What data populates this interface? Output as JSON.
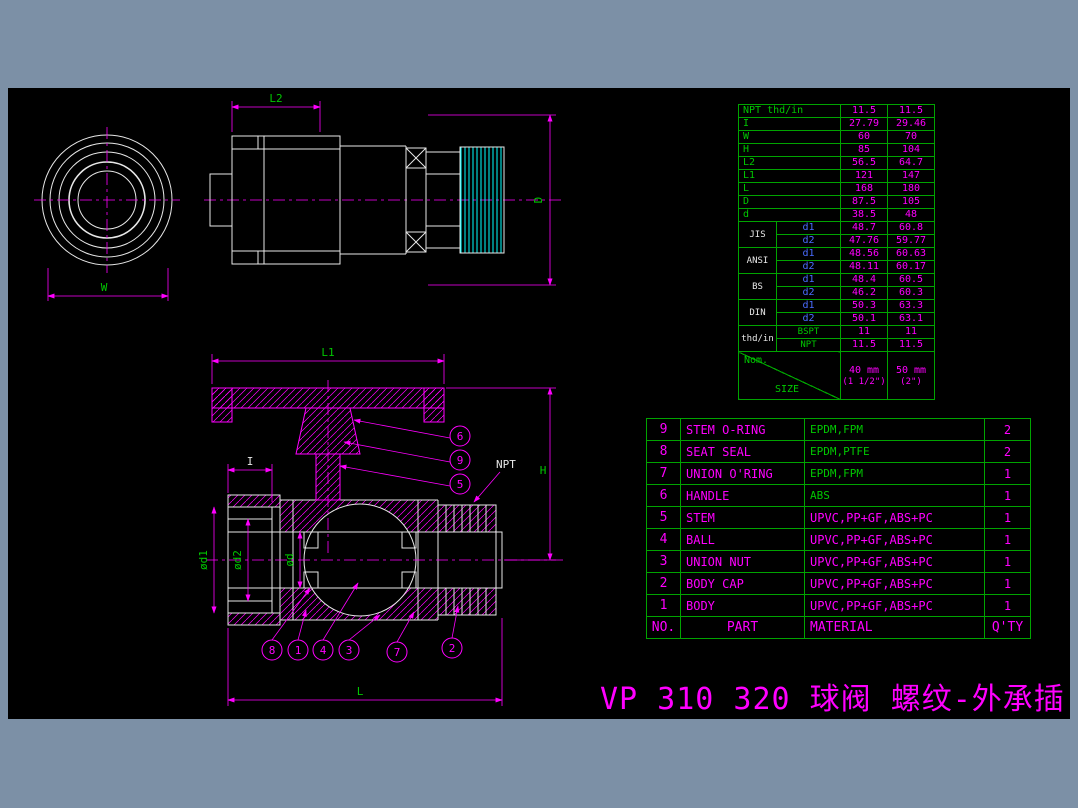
{
  "title": "VP 310 320 球阀 螺纹-外承插",
  "colors": {
    "frame": "#7C90A6",
    "canvas": "#000000",
    "geometry_white": "#E8E8E8",
    "dimension_magenta": "#FF00FF",
    "label_green": "#00C800",
    "table_border_green": "#00A400",
    "thread_cyan": "#00FFFF",
    "sub_label_blue": "#4A6CFF"
  },
  "dim_table": {
    "simple_rows": [
      [
        "NPT thd/in",
        "11.5",
        "11.5"
      ],
      [
        "I",
        "27.79",
        "29.46"
      ],
      [
        "W",
        "60",
        "70"
      ],
      [
        "H",
        "85",
        "104"
      ],
      [
        "L2",
        "56.5",
        "64.7"
      ],
      [
        "L1",
        "121",
        "147"
      ],
      [
        "L",
        "168",
        "180"
      ],
      [
        "D",
        "87.5",
        "105"
      ],
      [
        "d",
        "38.5",
        "48"
      ]
    ],
    "group_rows": [
      [
        "JIS",
        "d1",
        "48.7",
        "60.8"
      ],
      [
        "d2",
        "47.76",
        "59.77"
      ],
      [
        "ANSI",
        "d1",
        "48.56",
        "60.63"
      ],
      [
        "d2",
        "48.11",
        "60.17"
      ],
      [
        "BS",
        "d1",
        "48.4",
        "60.5"
      ],
      [
        "d2",
        "46.2",
        "60.3"
      ],
      [
        "DIN",
        "d1",
        "50.3",
        "63.3"
      ],
      [
        "d2",
        "50.1",
        "63.1"
      ],
      [
        "thd/in",
        "BSPT",
        "11",
        "11"
      ],
      [
        "NPT",
        "11.5",
        "11.5"
      ]
    ],
    "nom": {
      "label": "Nom.",
      "size_label": "SIZE",
      "col1": [
        "40 mm",
        "(1 1/2\")"
      ],
      "col2": [
        "50 mm",
        "(2\")"
      ]
    }
  },
  "parts_table": {
    "rows": [
      [
        "9",
        "STEM O-RING",
        "EPDM,FPM",
        "2"
      ],
      [
        "8",
        "SEAT SEAL",
        "EPDM,PTFE",
        "2"
      ],
      [
        "7",
        "UNION O'RING",
        "EPDM,FPM",
        "1"
      ],
      [
        "6",
        "HANDLE",
        "ABS",
        "1"
      ],
      [
        "5",
        "STEM",
        "UPVC,PP+GF,ABS+PC",
        "1"
      ],
      [
        "4",
        "BALL",
        "UPVC,PP+GF,ABS+PC",
        "1"
      ],
      [
        "3",
        "UNION NUT",
        "UPVC,PP+GF,ABS+PC",
        "1"
      ],
      [
        "2",
        "BODY CAP",
        "UPVC,PP+GF,ABS+PC",
        "1"
      ],
      [
        "1",
        "BODY",
        "UPVC,PP+GF,ABS+PC",
        "1"
      ]
    ],
    "footer": [
      "NO.",
      "PART",
      "MATERIAL",
      "Q'TY"
    ]
  },
  "drawing": {
    "front": {
      "w": "W"
    },
    "side": {
      "l2": "L2",
      "d": "D"
    },
    "section": {
      "l1": "L1",
      "i": "I",
      "od1": "ød1",
      "od2": "ød2",
      "od": "ød",
      "npt": "NPT",
      "h": "H",
      "l": "L"
    },
    "balloons": [
      "6",
      "9",
      "5",
      "8",
      "1",
      "4",
      "3",
      "7",
      "2"
    ]
  }
}
